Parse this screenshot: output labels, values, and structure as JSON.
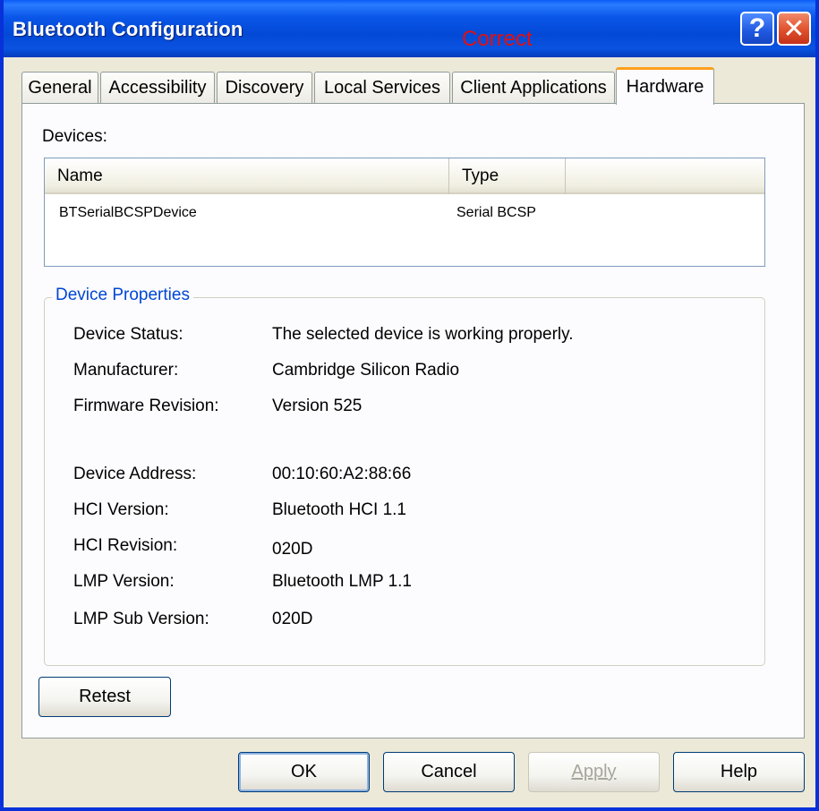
{
  "window": {
    "title": "Bluetooth Configuration",
    "overlay_text": "Correct",
    "help_glyph": "?",
    "close_glyph": "✕"
  },
  "tabs": [
    {
      "label": "General"
    },
    {
      "label": "Accessibility"
    },
    {
      "label": "Discovery"
    },
    {
      "label": "Local Services"
    },
    {
      "label": "Client Applications"
    },
    {
      "label": "Hardware",
      "active": true
    }
  ],
  "devices": {
    "label": "Devices:",
    "columns": [
      "Name",
      "Type"
    ],
    "rows": [
      {
        "name": "BTSerialBCSPDevice",
        "type": "Serial BCSP"
      }
    ]
  },
  "properties": {
    "legend": "Device Properties",
    "items": [
      {
        "label": "Device Status:",
        "value": "The selected device is working properly."
      },
      {
        "label": "Manufacturer:",
        "value": "Cambridge Silicon Radio"
      },
      {
        "label": "Firmware Revision:",
        "value": "Version 525"
      },
      {
        "label": "Device Address:",
        "value": "00:10:60:A2:88:66"
      },
      {
        "label": "HCI Version:",
        "value": "Bluetooth HCI 1.1"
      },
      {
        "label": "HCI Revision:",
        "value": "020D"
      },
      {
        "label": "LMP Version:",
        "value": "Bluetooth LMP 1.1"
      },
      {
        "label": "LMP Sub Version:",
        "value": "020D"
      }
    ]
  },
  "buttons": {
    "retest": "Retest",
    "ok": "OK",
    "cancel": "Cancel",
    "apply": "Apply",
    "help": "Help"
  },
  "colors": {
    "titlebar": "#0a56e8",
    "active_tab_accent": "#ff9f1c",
    "legend_text": "#0046d5",
    "overlay_text": "#e01010"
  }
}
